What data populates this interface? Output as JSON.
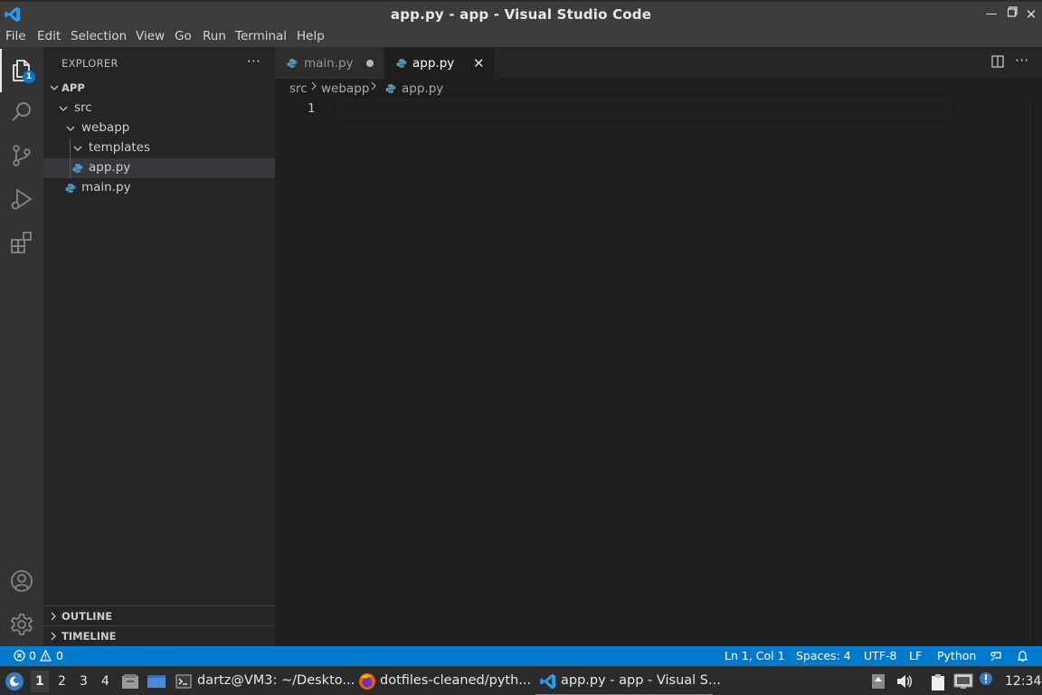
{
  "window": {
    "title": "app.py - app - Visual Studio Code",
    "controls": [
      "minimize-icon",
      "restore-icon",
      "close-icon"
    ]
  },
  "menu": [
    "File",
    "Edit",
    "Selection",
    "View",
    "Go",
    "Run",
    "Terminal",
    "Help"
  ],
  "activity_bar": {
    "items": [
      "explorer-icon",
      "search-icon",
      "source-control-icon",
      "run-debug-icon",
      "extensions-icon"
    ],
    "bottom": [
      "accounts-icon",
      "settings-gear-icon"
    ],
    "explorer_badge": "1"
  },
  "sidebar": {
    "title": "EXPLORER",
    "more": "···",
    "root": "APP",
    "tree": {
      "src": "src",
      "webapp": "webapp",
      "templates": "templates",
      "app_py": "app.py",
      "main_py": "main.py"
    },
    "sections": {
      "outline": "OUTLINE",
      "timeline": "TIMELINE"
    }
  },
  "tabs": [
    {
      "label": "main.py",
      "dirty": true,
      "active": false
    },
    {
      "label": "app.py",
      "dirty": false,
      "active": true
    }
  ],
  "breadcrumb": [
    "src",
    "webapp",
    "app.py"
  ],
  "editor": {
    "line_numbers": [
      "1"
    ]
  },
  "status_bar": {
    "errors": "0",
    "warnings": "0",
    "position": "Ln 1, Col 1",
    "spaces": "Spaces: 4",
    "encoding": "UTF-8",
    "eol": "LF",
    "language": "Python"
  },
  "taskbar": {
    "workspaces": [
      "1",
      "2",
      "3",
      "4"
    ],
    "tasks": [
      {
        "label": "dartz@VM3: ~/Deskto..."
      },
      {
        "label": "dotfiles-cleaned/pyth..."
      },
      {
        "label": "app.py - app - Visual S..."
      }
    ],
    "clock": "12:34"
  },
  "colors": {
    "accent": "#007acc",
    "python_icon": "#519aba"
  }
}
